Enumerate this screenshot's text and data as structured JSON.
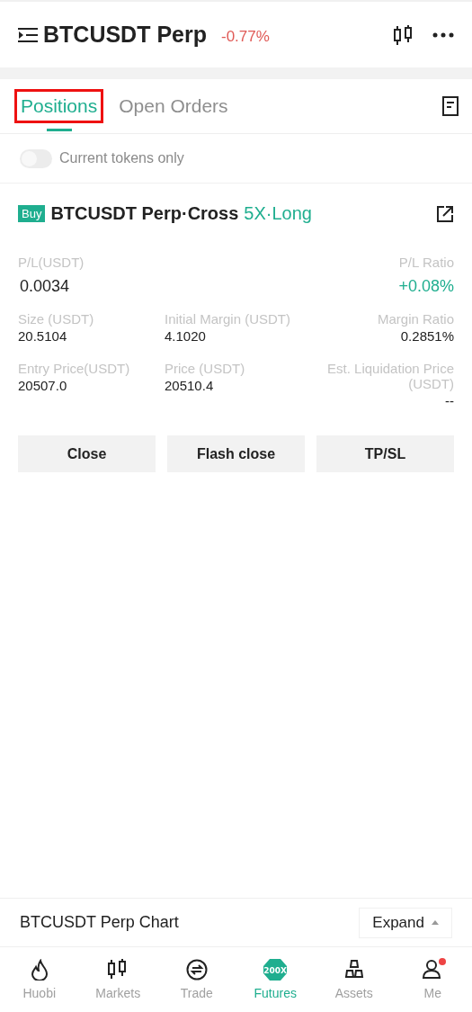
{
  "header": {
    "title": "BTCUSDT Perp",
    "change": "-0.77%"
  },
  "tabs": [
    {
      "label": "Positions",
      "selected": true,
      "annotated": true
    },
    {
      "label": "Open Orders",
      "selected": false,
      "annotated": false
    }
  ],
  "filter": {
    "label": "Current tokens only",
    "on": false
  },
  "position": {
    "side": "Buy",
    "symbol": "BTCUSDT Perp·Cross",
    "leverage": "5X·Long",
    "pl_label": "P/L(USDT)",
    "pl_value": "0.0034",
    "ratio_label": "P/L Ratio",
    "ratio_value": "+0.08%",
    "fields": [
      {
        "label": "Size (USDT)",
        "value": "20.5104"
      },
      {
        "label": "Initial Margin (USDT)",
        "value": "4.1020"
      },
      {
        "label": "Margin Ratio",
        "value": "0.2851%"
      },
      {
        "label": "Entry Price(USDT)",
        "value": "20507.0"
      },
      {
        "label": "Price (USDT)",
        "value": "20510.4"
      },
      {
        "label": "Est. Liquidation Price (USDT)",
        "value": "--"
      }
    ],
    "buttons": [
      "Close",
      "Flash close",
      "TP/SL"
    ]
  },
  "chart_bar": {
    "title": "BTCUSDT Perp Chart",
    "button": "Expand"
  },
  "nav": [
    {
      "label": "Huobi",
      "kind": "flame",
      "selected": false,
      "badge": false
    },
    {
      "label": "Markets",
      "kind": "candles",
      "selected": false,
      "badge": false
    },
    {
      "label": "Trade",
      "kind": "swap",
      "selected": false,
      "badge": false
    },
    {
      "label": "Futures",
      "kind": "futures",
      "icon_text": "200X",
      "selected": true,
      "badge": false
    },
    {
      "label": "Assets",
      "kind": "bars",
      "selected": false,
      "badge": false
    },
    {
      "label": "Me",
      "kind": "person",
      "selected": false,
      "badge": true
    }
  ]
}
